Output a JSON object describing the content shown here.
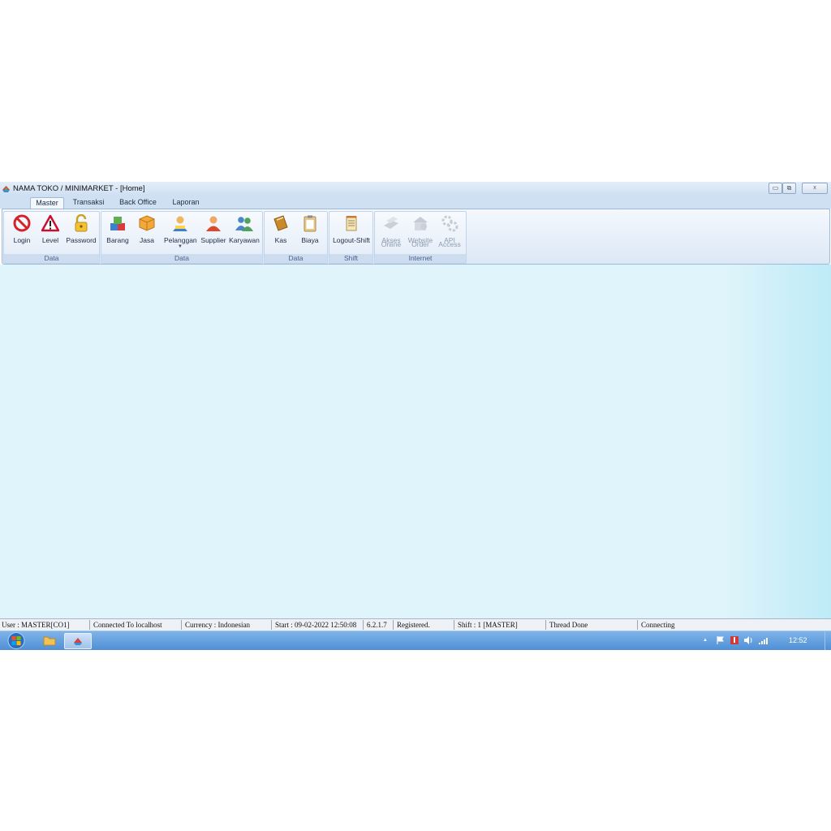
{
  "window": {
    "title": "NAMA TOKO / MINIMARKET - [Home]",
    "minimize_label": "▭",
    "restore_label": "⧉",
    "close_label": "☓"
  },
  "tabs": [
    {
      "label": "Master",
      "active": true
    },
    {
      "label": "Transaksi",
      "active": false
    },
    {
      "label": "Back Office",
      "active": false
    },
    {
      "label": "Laporan",
      "active": false
    }
  ],
  "ribbon": {
    "groups": [
      {
        "label": "Data",
        "buttons": [
          {
            "label": "Login",
            "icon": "no-entry-icon"
          },
          {
            "label": "Level",
            "icon": "warning-icon"
          },
          {
            "label": "Password",
            "icon": "lock-icon"
          }
        ]
      },
      {
        "label": "Data",
        "buttons": [
          {
            "label": "Barang",
            "icon": "boxes-icon"
          },
          {
            "label": "Jasa",
            "icon": "package-icon"
          },
          {
            "label": "Pelanggan",
            "icon": "customer-icon"
          },
          {
            "label": "Supplier",
            "icon": "supplier-icon"
          },
          {
            "label": "Karyawan",
            "icon": "employees-icon"
          }
        ]
      },
      {
        "label": "Data",
        "buttons": [
          {
            "label": "Kas",
            "icon": "cash-book-icon"
          },
          {
            "label": "Biaya",
            "icon": "clipboard-icon"
          }
        ]
      },
      {
        "label": "Shift",
        "buttons": [
          {
            "label": "Logout-Shift",
            "icon": "notepad-icon"
          }
        ]
      },
      {
        "label": "Internet",
        "buttons": [
          {
            "label": "Akses",
            "label2": "Online",
            "icon": "online-access-icon"
          },
          {
            "label": "Website",
            "label2": "Order",
            "icon": "website-order-icon"
          },
          {
            "label": "API",
            "label2": "Access",
            "icon": "api-gear-icon"
          }
        ]
      }
    ]
  },
  "statusbar": {
    "user": "User : MASTER[CO1]",
    "connection": "Connected To localhost",
    "currency": "Currency : Indonesian",
    "start": "Start : 09-02-2022 12:50:08",
    "version": "6.2.1.7",
    "registration": "Registered.",
    "shift": "Shift : 1 [MASTER]",
    "thread": "Thread Done",
    "network": "Connecting"
  },
  "taskbar": {
    "clock": "12:52",
    "tray_up": "▲",
    "colors": {
      "accent": "#4f8fd6"
    }
  }
}
